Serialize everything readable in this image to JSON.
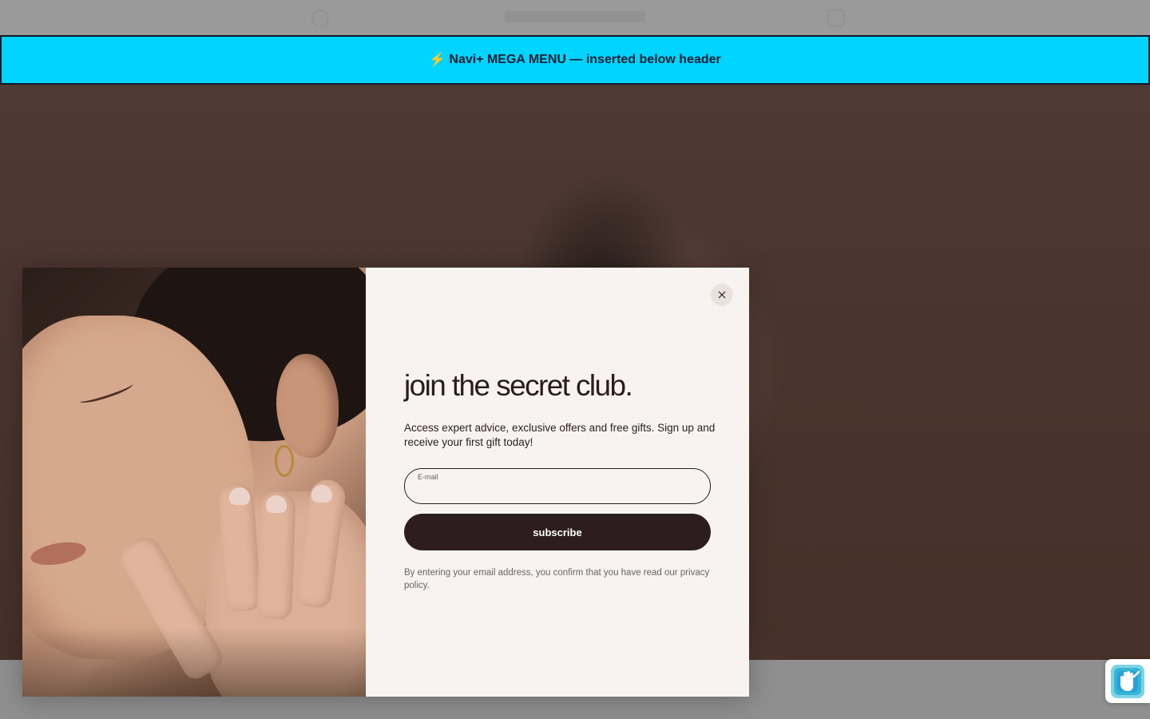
{
  "banner": {
    "icon": "lightning-bolt-icon",
    "bolt_glyph": "⚡",
    "text": "Navi+ MEGA MENU — inserted below header",
    "background": "#00d4ff",
    "border": "#0e1b2a"
  },
  "popup": {
    "title": "join the secret club.",
    "description": "Access expert advice, exclusive offers and free gifts. Sign up and receive your first gift today!",
    "email": {
      "label": "E-mail",
      "value": "",
      "placeholder": ""
    },
    "subscribe_label": "subscribe",
    "legal_text": "By entering your email address, you confirm that you have read our privacy policy.",
    "close_icon": "close-icon",
    "panel_color": "#f8f3f0",
    "button_color": "#2d1d1f",
    "text_color": "#2b1c1e"
  },
  "accessibility_widget": {
    "icon": "accessibility-hand-icon",
    "colors": [
      "#1fb4c8",
      "#3aa0e0"
    ]
  },
  "overlay": {
    "dim_color": "#8f8f8f"
  }
}
